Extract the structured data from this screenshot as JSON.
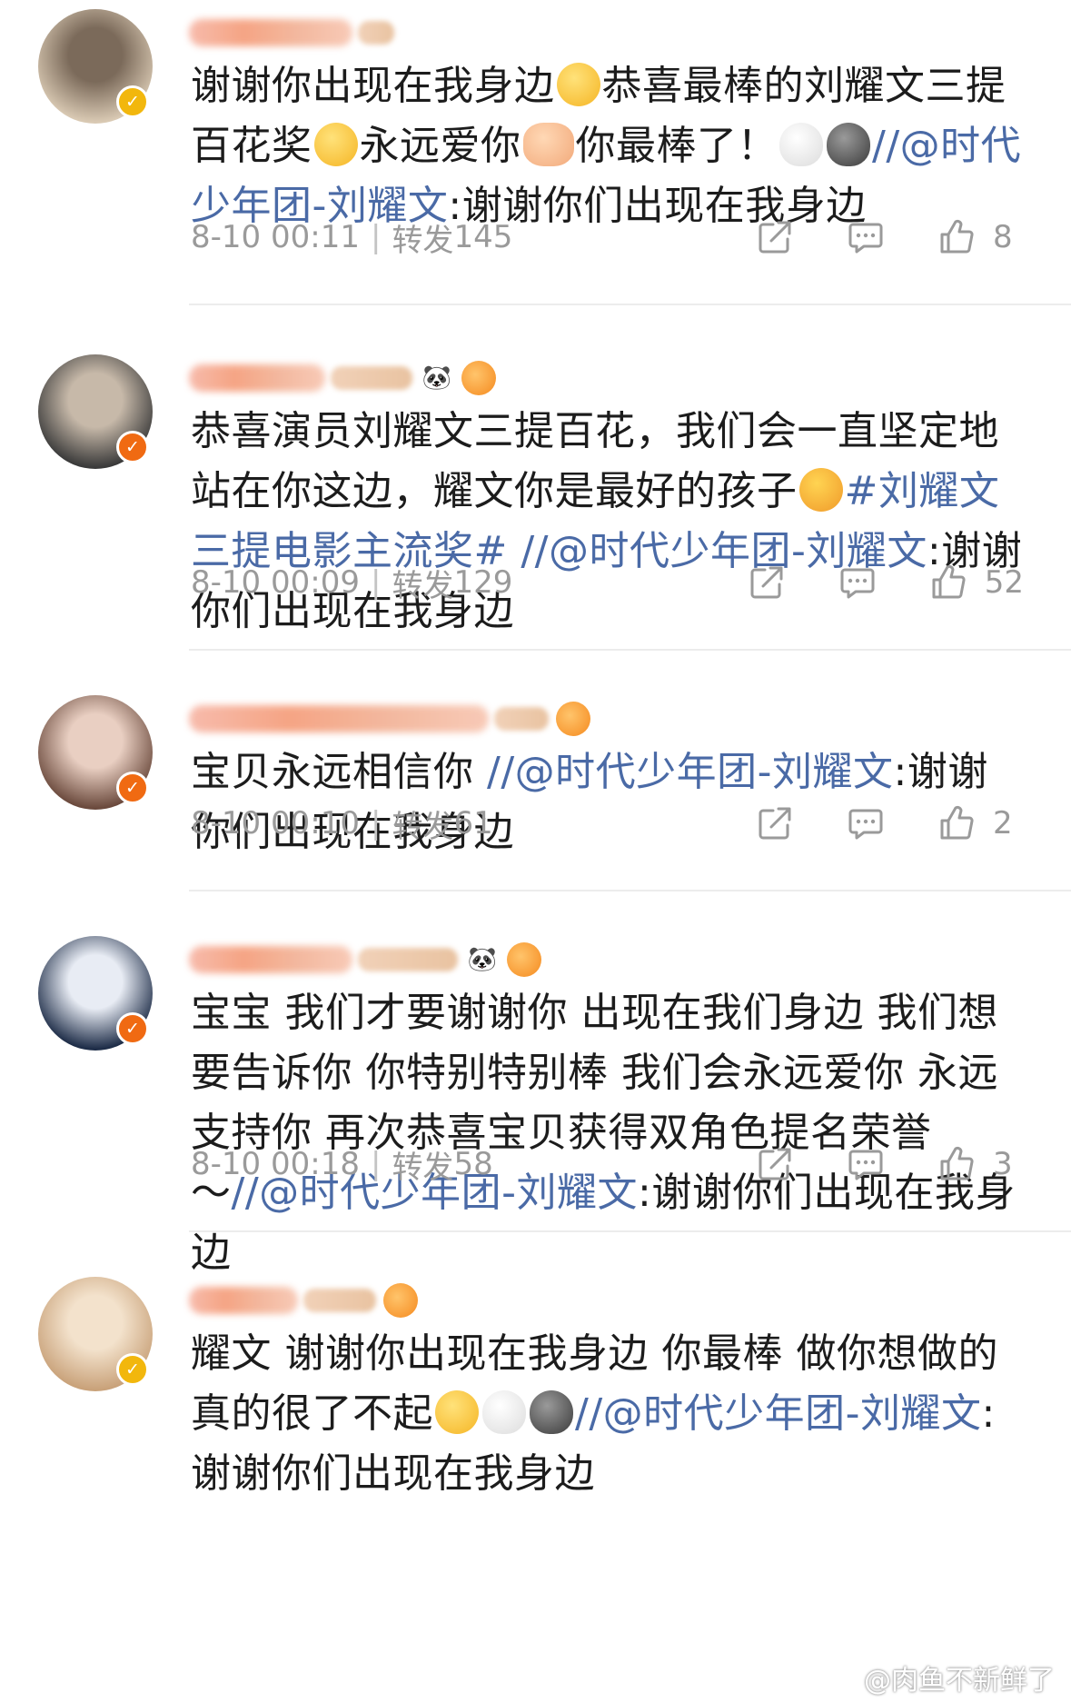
{
  "comments": [
    {
      "badge_color": "#f2b70d",
      "avatar_colors": [
        "#d9c9b3",
        "#7b6a5a"
      ],
      "text": [
        {
          "t": "谢谢你出现在我身边"
        },
        {
          "emoji": "pleading-hands-icon"
        },
        {
          "t": "恭喜最棒的刘耀文三提百花奖"
        },
        {
          "emoji": "pleading-face-icon"
        },
        {
          "t": "永远爱你"
        },
        {
          "emoji": "heart-hands-icon"
        },
        {
          "t": "你最棒了！"
        },
        {
          "emoji": "white-heart-icon"
        },
        {
          "emoji": "grey-heart-icon"
        },
        {
          "t": "//",
          "link": true
        },
        {
          "t": "@时代少年团-刘耀文",
          "link": true
        },
        {
          "t": ":谢谢你们出现在我身边"
        }
      ],
      "time": "8-10 00:11",
      "repost_label": "转发",
      "repost_count": "145",
      "like_count": "8"
    },
    {
      "badge_color": "#f06a12",
      "avatar_colors": [
        "#3a3a3a",
        "#c7b9a9"
      ],
      "text": [
        {
          "t": "恭喜演员刘耀文三提百花，我们会一直坚定地站在你这边，耀文你是最好的孩子"
        },
        {
          "emoji": "hugging-face-icon"
        },
        {
          "t": "#刘耀文三提电影主流奖#",
          "link": true
        },
        {
          "t": " //",
          "link": true
        },
        {
          "t": "@时代少年团-刘耀文",
          "link": true
        },
        {
          "t": ":谢谢你们出现在我身边"
        }
      ],
      "time": "8-10 00:09",
      "repost_label": "转发",
      "repost_count": "129",
      "like_count": "52"
    },
    {
      "badge_color": "#f06a12",
      "avatar_colors": [
        "#6b4a3d",
        "#e9cfc2"
      ],
      "text": [
        {
          "t": "宝贝永远相信你 "
        },
        {
          "t": "//",
          "link": true
        },
        {
          "t": "@时代少年团-刘耀文",
          "link": true
        },
        {
          "t": ":谢谢你们出现在我身边"
        }
      ],
      "time": "8-10 00:10",
      "repost_label": "转发",
      "repost_count": "61",
      "like_count": "2"
    },
    {
      "badge_color": "#f06a12",
      "avatar_colors": [
        "#1e2d48",
        "#e8ecf4"
      ],
      "text": [
        {
          "t": "宝宝 我们才要谢谢你 出现在我们身边 我们想要告诉你 你特别特别棒 我们会永远爱你 永远支持你 再次恭喜宝贝获得双角色提名荣誉～"
        },
        {
          "t": "//",
          "link": true
        },
        {
          "t": "@时代少年团-刘耀文",
          "link": true
        },
        {
          "t": ":谢谢你们出现在我身边"
        }
      ],
      "time": "8-10 00:18",
      "repost_label": "转发",
      "repost_count": "58",
      "like_count": "3"
    },
    {
      "badge_color": "#f2b70d",
      "avatar_colors": [
        "#c9a27a",
        "#f3e2cc"
      ],
      "text": [
        {
          "t": "耀文 谢谢你出现在我身边 你最棒 做你想做的真的很了不起"
        },
        {
          "emoji": "pleading-face-icon"
        },
        {
          "emoji": "white-heart-icon"
        },
        {
          "emoji": "grey-heart-icon"
        },
        {
          "t": "//",
          "link": true
        },
        {
          "t": "@时代少年团-刘耀文",
          "link": true
        },
        {
          "t": ":谢谢你们出现在我身边"
        }
      ]
    }
  ],
  "watermark": "@肉鱼不新鲜了",
  "link_color": "#4a6aa6",
  "meta_color": "#9a9a9a"
}
